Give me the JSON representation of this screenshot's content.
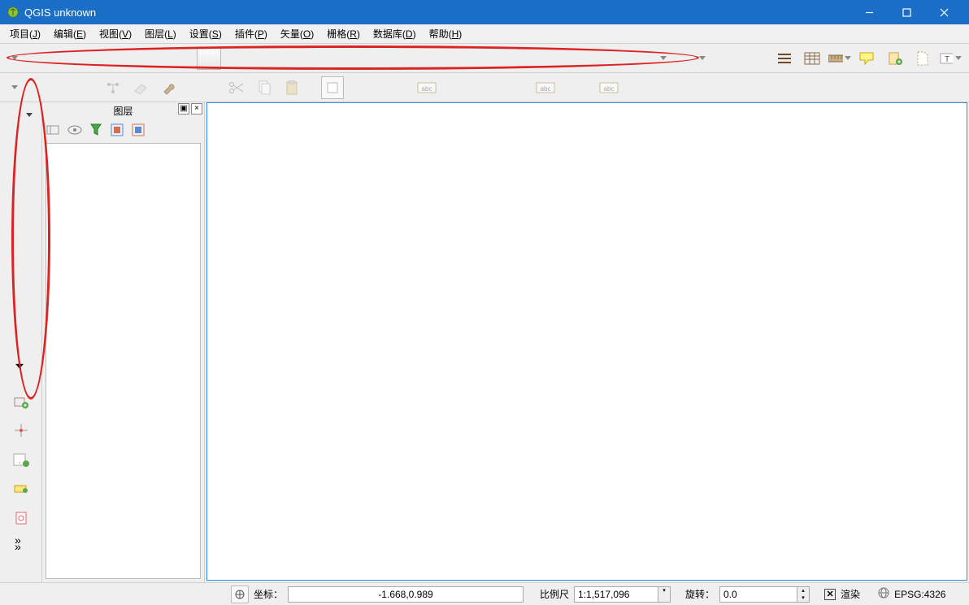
{
  "window": {
    "title": "QGIS unknown"
  },
  "menu": {
    "items": [
      {
        "label": "项目",
        "mn": "J"
      },
      {
        "label": "编辑",
        "mn": "E"
      },
      {
        "label": "视图",
        "mn": "V"
      },
      {
        "label": "图层",
        "mn": "L"
      },
      {
        "label": "设置",
        "mn": "S"
      },
      {
        "label": "插件",
        "mn": "P"
      },
      {
        "label": "矢量",
        "mn": "O"
      },
      {
        "label": "栅格",
        "mn": "R"
      },
      {
        "label": "数据库",
        "mn": "D"
      },
      {
        "label": "帮助",
        "mn": "H"
      }
    ]
  },
  "panels": {
    "layers": {
      "title": "图层"
    }
  },
  "statusbar": {
    "coord_label": "坐标：",
    "coord_value": "-1.668,0.989",
    "scale_label": "比例尺",
    "scale_value": "1:1,517,096",
    "rotate_label": "旋转：",
    "rotate_value": "0.0",
    "render_label": "渲染",
    "epsg": "EPSG:4326"
  }
}
